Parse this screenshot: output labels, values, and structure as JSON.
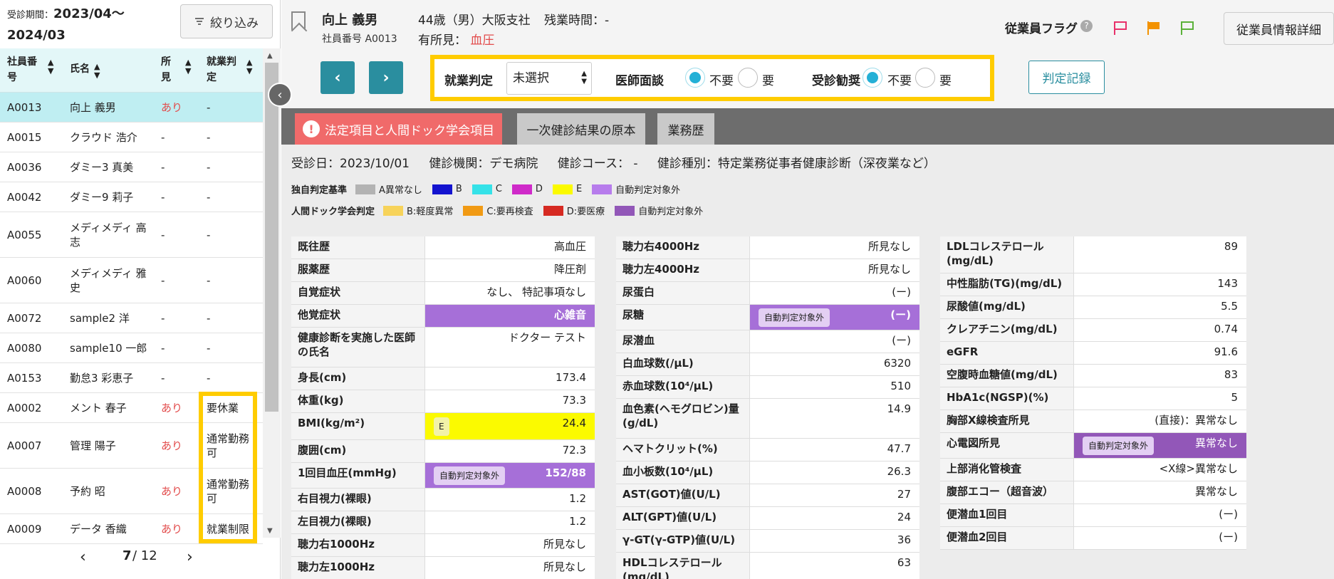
{
  "left": {
    "period_label": "受診期間：",
    "period_value": "2023/04〜2024/03",
    "filter_label": "絞り込み",
    "columns": [
      "社員番号",
      "氏名",
      "所見",
      "就業判定"
    ],
    "rows": [
      {
        "id": "A0013",
        "name": "向上 義男",
        "finding": "あり",
        "judge": "-"
      },
      {
        "id": "A0015",
        "name": "クラウド 浩介",
        "finding": "-",
        "judge": "-"
      },
      {
        "id": "A0036",
        "name": "ダミー3 真美",
        "finding": "-",
        "judge": "-"
      },
      {
        "id": "A0042",
        "name": "ダミー9 莉子",
        "finding": "-",
        "judge": "-"
      },
      {
        "id": "A0055",
        "name": "メディメディ 高志",
        "finding": "-",
        "judge": "-"
      },
      {
        "id": "A0060",
        "name": "メディメディ 雅史",
        "finding": "-",
        "judge": "-"
      },
      {
        "id": "A0072",
        "name": "sample2 洋",
        "finding": "-",
        "judge": "-"
      },
      {
        "id": "A0080",
        "name": "sample10 一郎",
        "finding": "-",
        "judge": "-"
      },
      {
        "id": "A0153",
        "name": "勤怠3 彩恵子",
        "finding": "-",
        "judge": "-"
      },
      {
        "id": "A0002",
        "name": "メント 春子",
        "finding": "あり",
        "judge": "要休業"
      },
      {
        "id": "A0007",
        "name": "管理 陽子",
        "finding": "あり",
        "judge": "通常勤務可"
      },
      {
        "id": "A0008",
        "name": "予約 昭",
        "finding": "あり",
        "judge": "通常勤務可"
      },
      {
        "id": "A0009",
        "name": "データ 香織",
        "finding": "あり",
        "judge": "就業制限"
      }
    ],
    "pager": {
      "current": "7",
      "total": "/ 12"
    }
  },
  "header": {
    "name": "向上 義男",
    "employee_no": "社員番号 A0013",
    "age": "44歳（男）大阪支社",
    "overtime": "残業時間：-",
    "finding_label": "有所見：",
    "finding_value": "血圧",
    "flag_label": "従業員フラグ",
    "detail_button": "従業員情報詳細",
    "judge_label": "就業判定",
    "judge_value": "未選択",
    "interview_label": "医師面談",
    "exam_label": "受診勧奨",
    "opt_no": "不要",
    "opt_yes": "要",
    "record_button": "判定記録"
  },
  "tabs": [
    "法定項目と人間ドック学会項目",
    "一次健診結果の原本",
    "業務歴"
  ],
  "exam": {
    "date": "受診日：2023/10/01",
    "facility": "健診機関：デモ病院",
    "course": "健診コース： -",
    "type": "健診種別：特定業務従事者健康診断（深夜業など）"
  },
  "legend1": {
    "title": "独自判定基準",
    "items": [
      {
        "label": "A異常なし",
        "color": "#b3b3b3"
      },
      {
        "label": "B",
        "color": "#1313cf"
      },
      {
        "label": "C",
        "color": "#35e2e8"
      },
      {
        "label": "D",
        "color": "#cf2ac9"
      },
      {
        "label": "E",
        "color": "#fbfa00"
      },
      {
        "label": "自動判定対象外",
        "color": "#b77cec"
      }
    ]
  },
  "legend2": {
    "title": "人間ドック学会判定",
    "items": [
      {
        "label": "B:軽度異常",
        "color": "#f7d35a"
      },
      {
        "label": "C:要再検査",
        "color": "#f19a14"
      },
      {
        "label": "D:要医療",
        "color": "#d62a22"
      },
      {
        "label": "自動判定対象外",
        "color": "#9257b8"
      }
    ]
  },
  "chip_auto": "自動判定対象外",
  "chip_e": "E",
  "table1": [
    {
      "label": "既往歴",
      "value": "高血圧"
    },
    {
      "label": "服薬歴",
      "value": "降圧剤"
    },
    {
      "label": "自覚症状",
      "value": "なし、 特記事項なし"
    },
    {
      "label": "他覚症状",
      "value": "心雑音"
    },
    {
      "label": "健康診断を実施した医師の氏名",
      "value": "ドクター テスト"
    },
    {
      "label": "身長(cm)",
      "value": "173.4"
    },
    {
      "label": "体重(kg)",
      "value": "73.3"
    },
    {
      "label": "BMI(kg/m²)",
      "value": "24.4"
    },
    {
      "label": "腹囲(cm)",
      "value": "72.3"
    },
    {
      "label": "1回目血圧(mmHg)",
      "value": "152/88"
    },
    {
      "label": "右目視力(裸眼)",
      "value": "1.2"
    },
    {
      "label": "左目視力(裸眼)",
      "value": "1.2"
    },
    {
      "label": "聴力右1000Hz",
      "value": "所見なし"
    },
    {
      "label": "聴力左1000Hz",
      "value": "所見なし"
    }
  ],
  "table2": [
    {
      "label": "聴力右4000Hz",
      "value": "所見なし"
    },
    {
      "label": "聴力左4000Hz",
      "value": "所見なし"
    },
    {
      "label": "尿蛋白",
      "value": "(ー)"
    },
    {
      "label": "尿糖",
      "value": "(ー)"
    },
    {
      "label": "尿潜血",
      "value": "(ー)"
    },
    {
      "label": "白血球数(/μL)",
      "value": "6320"
    },
    {
      "label": "赤血球数(10⁴/μL)",
      "value": "510"
    },
    {
      "label": "血色素(ヘモグロビン)量(g/dL)",
      "value": "14.9"
    },
    {
      "label": "ヘマトクリット(%)",
      "value": "47.7"
    },
    {
      "label": "血小板数(10⁴/μL)",
      "value": "26.3"
    },
    {
      "label": "AST(GOT)値(U/L)",
      "value": "27"
    },
    {
      "label": "ALT(GPT)値(U/L)",
      "value": "24"
    },
    {
      "label": "γ-GT(γ-GTP)値(U/L)",
      "value": "36"
    },
    {
      "label": "HDLコレステロール(mg/dL)",
      "value": "63"
    }
  ],
  "table3": [
    {
      "label": "LDLコレステロール(mg/dL)",
      "value": "89"
    },
    {
      "label": "中性脂肪(TG)(mg/dL)",
      "value": "143"
    },
    {
      "label": "尿酸値(mg/dL)",
      "value": "5.5"
    },
    {
      "label": "クレアチニン(mg/dL)",
      "value": "0.74"
    },
    {
      "label": "eGFR",
      "value": "91.6"
    },
    {
      "label": "空腹時血糖値(mg/dL)",
      "value": "83"
    },
    {
      "label": "HbA1c(NGSP)(%)",
      "value": "5"
    },
    {
      "label": "胸部X線検査所見",
      "value": "(直接)：異常なし"
    },
    {
      "label": "心電図所見",
      "value": "異常なし"
    },
    {
      "label": "上部消化管検査",
      "value": "<X線>異常なし"
    },
    {
      "label": "腹部エコー（超音波）",
      "value": "異常なし"
    },
    {
      "label": "便潜血1回目",
      "value": "(ー)"
    },
    {
      "label": "便潜血2回目",
      "value": "(ー)"
    }
  ],
  "colors": {
    "accent": "#2a8e9f",
    "highlight": "#ffcc00",
    "flag_red": "#e8316a",
    "flag_orange": "#f39200",
    "flag_green": "#5bb13a"
  }
}
